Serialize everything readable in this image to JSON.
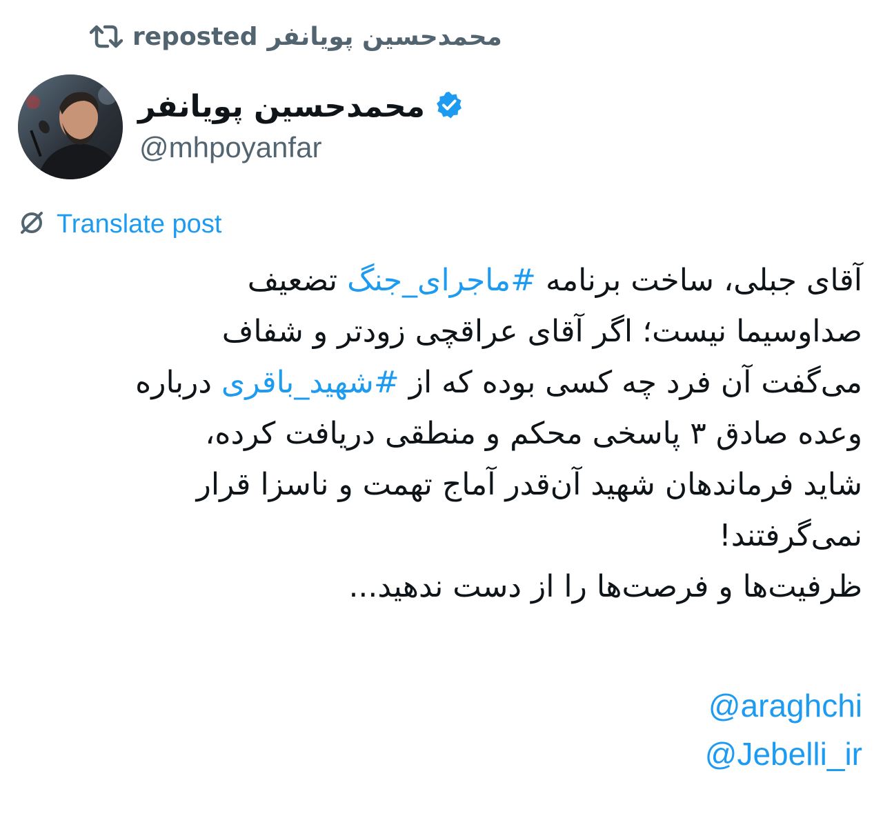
{
  "repost": {
    "user_name": "محمدحسین پویانفر",
    "label": "reposted",
    "icon": "repost-icon"
  },
  "author": {
    "display_name": "محمدحسین پویانفر",
    "handle": "@mhpoyanfar",
    "verified_icon": "verified-badge-icon",
    "avatar": "avatar"
  },
  "translate": {
    "icon": "translate-icon",
    "label": "Translate post"
  },
  "post": {
    "lines": [
      {
        "before": "آقای جبلی، ساخت برنامه ",
        "hashtag": "#ماجرای_جنگ",
        "after": " تضعیف"
      },
      {
        "text": "صداوسیما نیست؛ اگر آقای عراقچی زودتر و شفاف"
      },
      {
        "before": "می‌گفت آن فرد چه کسی بوده که از ",
        "hashtag": "#شهید_باقری",
        "after": " درباره"
      },
      {
        "text": "وعده صادق ۳ پاسخی محکم و منطقی دریافت کرده،"
      },
      {
        "text": "شاید فرماندهان شهید آن‌قدر آماج تهمت و ناسزا قرار"
      },
      {
        "text": "نمی‌گرفتند!"
      },
      {
        "text": "ظرفیت‌ها و فرصت‌ها را از دست ندهید..."
      }
    ],
    "mentions": [
      "@araghchi",
      "@Jebelli_ir"
    ]
  },
  "colors": {
    "accent": "#1d9bf0",
    "text": "#0f1419",
    "secondary": "#536471"
  }
}
